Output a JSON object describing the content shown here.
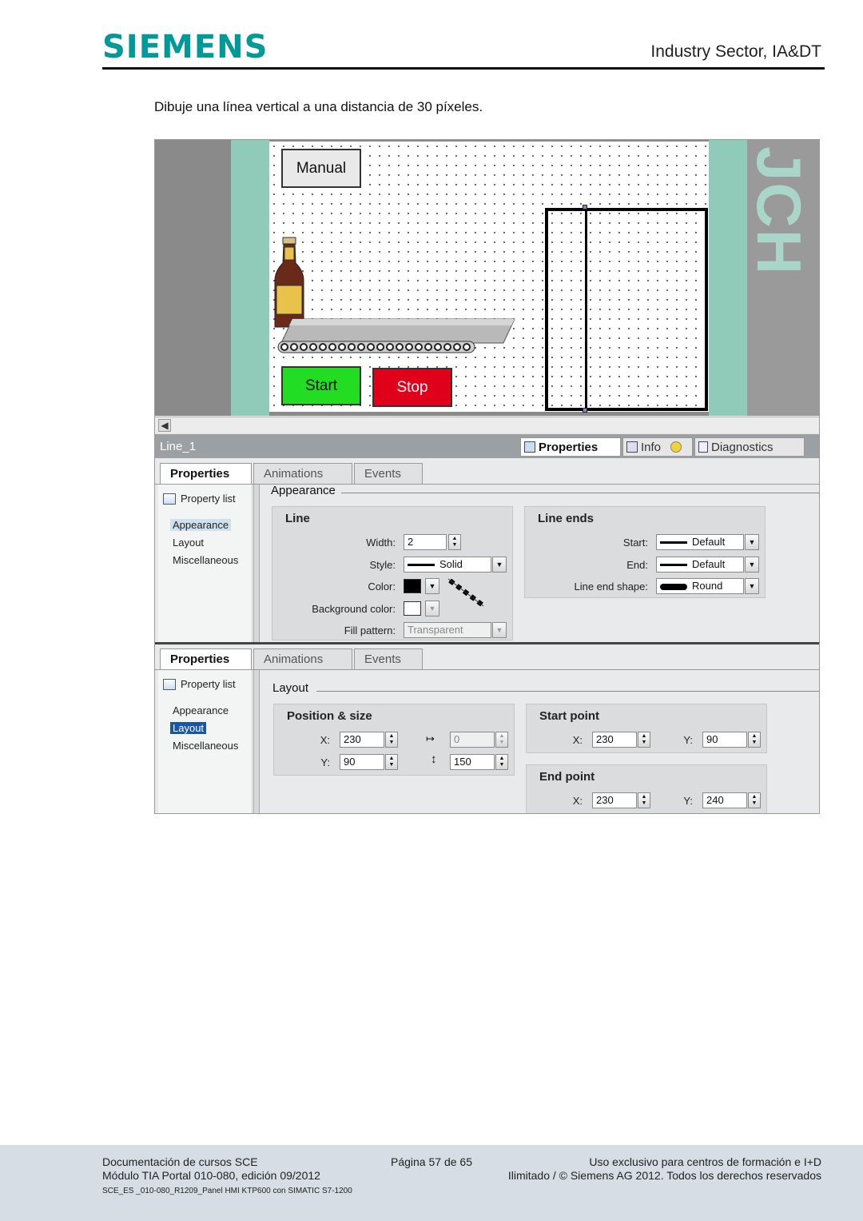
{
  "header": {
    "logo": "SIEMENS",
    "sector": "Industry Sector, IA&DT"
  },
  "intro_text": "Dibuje una línea vertical a una distancia de 30 píxeles.",
  "hmi": {
    "touch_text": "JCH",
    "buttons": {
      "manual": "Manual",
      "start": "Start",
      "stop": "Stop"
    },
    "colors": {
      "start": "#22dd22",
      "stop": "#e0001a",
      "bezel": "#8fcbb8"
    }
  },
  "inspector": {
    "object_name": "Line_1",
    "tabs": {
      "properties": "Properties",
      "info": "Info",
      "diagnostics": "Diagnostics"
    }
  },
  "panel_appearance": {
    "tabs": [
      "Properties",
      "Animations",
      "Events"
    ],
    "property_list": "Property list",
    "side_items": [
      "Appearance",
      "Layout",
      "Miscellaneous"
    ],
    "section_title": "Appearance",
    "line_group": {
      "title": "Line",
      "width_label": "Width:",
      "width_value": "2",
      "style_label": "Style:",
      "style_value": "Solid",
      "color_label": "Color:",
      "bg_color_label": "Background color:",
      "fill_label": "Fill pattern:",
      "fill_value": "Transparent"
    },
    "line_ends_group": {
      "title": "Line ends",
      "start_label": "Start:",
      "start_value": "Default",
      "end_label": "End:",
      "end_value": "Default",
      "shape_label": "Line end shape:",
      "shape_value": "Round"
    }
  },
  "panel_layout": {
    "tabs": [
      "Properties",
      "Animations",
      "Events"
    ],
    "property_list": "Property list",
    "side_items": [
      "Appearance",
      "Layout",
      "Miscellaneous"
    ],
    "section_title": "Layout",
    "position_group": {
      "title": "Position & size",
      "x_label": "X:",
      "x_value": "230",
      "y_label": "Y:",
      "y_value": "90",
      "w_value": "0",
      "h_value": "150"
    },
    "start_point": {
      "title": "Start point",
      "x_label": "X:",
      "x_value": "230",
      "y_label": "Y:",
      "y_value": "90"
    },
    "end_point": {
      "title": "End point",
      "x_label": "X:",
      "x_value": "230",
      "y_label": "Y:",
      "y_value": "240"
    }
  },
  "footer": {
    "left1": "Documentación de cursos SCE",
    "left2": "Módulo TIA Portal 010-080, edición 09/2012",
    "center": "Página 57 de 65",
    "right1": "Uso exclusivo para centros de formación e I+D",
    "right2": "Ilimitado / © Siemens AG 2012. Todos los derechos reservados",
    "small": "SCE_ES _010-080_R1209_Panel HMI KTP600 con SIMATIC S7-1200"
  }
}
